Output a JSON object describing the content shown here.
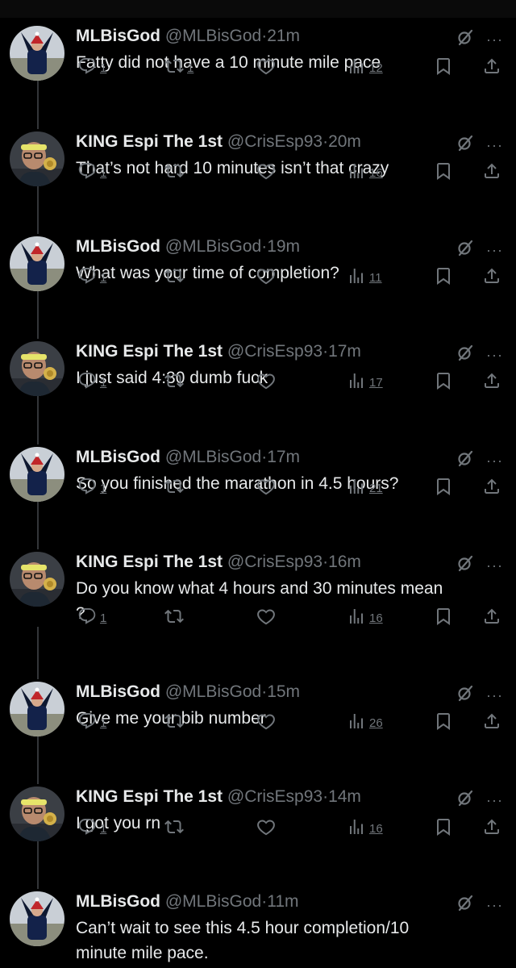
{
  "tweets": [
    {
      "name": "MLBisGod",
      "handle": "@MLBisGod",
      "time": "21m",
      "text": "Fatty did not have a 10 minute mile pace",
      "replies": "1",
      "reposts": "1",
      "views": "12",
      "avatar": "mlb"
    },
    {
      "name": "KING Espi The 1st",
      "handle": "@CrisEsp93",
      "time": "20m",
      "text": "That’s not hard 10 minutes isn’t that crazy",
      "replies": "1",
      "reposts": "",
      "views": "16",
      "avatar": "espi"
    },
    {
      "name": "MLBisGod",
      "handle": "@MLBisGod",
      "time": "19m",
      "text": "What was your time of completion?",
      "replies": "1",
      "reposts": "",
      "views": "11",
      "avatar": "mlb"
    },
    {
      "name": "KING Espi The 1st",
      "handle": "@CrisEsp93",
      "time": "17m",
      "text": "I just said 4:30 dumb fuck",
      "replies": "1",
      "reposts": "",
      "views": "17",
      "avatar": "espi"
    },
    {
      "name": "MLBisGod",
      "handle": "@MLBisGod",
      "time": "17m",
      "text": "So you finished the marathon in 4.5 hours?",
      "replies": "1",
      "reposts": "",
      "views": "21",
      "avatar": "mlb"
    },
    {
      "name": "KING Espi The 1st",
      "handle": "@CrisEsp93",
      "time": "16m",
      "text": "Do you know what 4 hours and 30 minutes mean ?",
      "replies": "1",
      "reposts": "",
      "views": "16",
      "avatar": "espi"
    },
    {
      "name": "MLBisGod",
      "handle": "@MLBisGod",
      "time": "15m",
      "text": "Give me your bib number",
      "replies": "1",
      "reposts": "",
      "views": "26",
      "avatar": "mlb"
    },
    {
      "name": "KING Espi The 1st",
      "handle": "@CrisEsp93",
      "time": "14m",
      "text": "I got you rn",
      "replies": "1",
      "reposts": "",
      "views": "16",
      "avatar": "espi"
    },
    {
      "name": "MLBisGod",
      "handle": "@MLBisGod",
      "time": "11m",
      "text": "Can’t wait to see this 4.5 hour completion/10 minute mile pace.",
      "replies": "",
      "reposts": "",
      "views": "",
      "avatar": "mlb"
    }
  ],
  "labels": {
    "dot": "·",
    "more": "···"
  },
  "colors": {
    "background": "#000000",
    "text": "#e7e9ea",
    "muted": "#71767b",
    "line": "#333639"
  }
}
